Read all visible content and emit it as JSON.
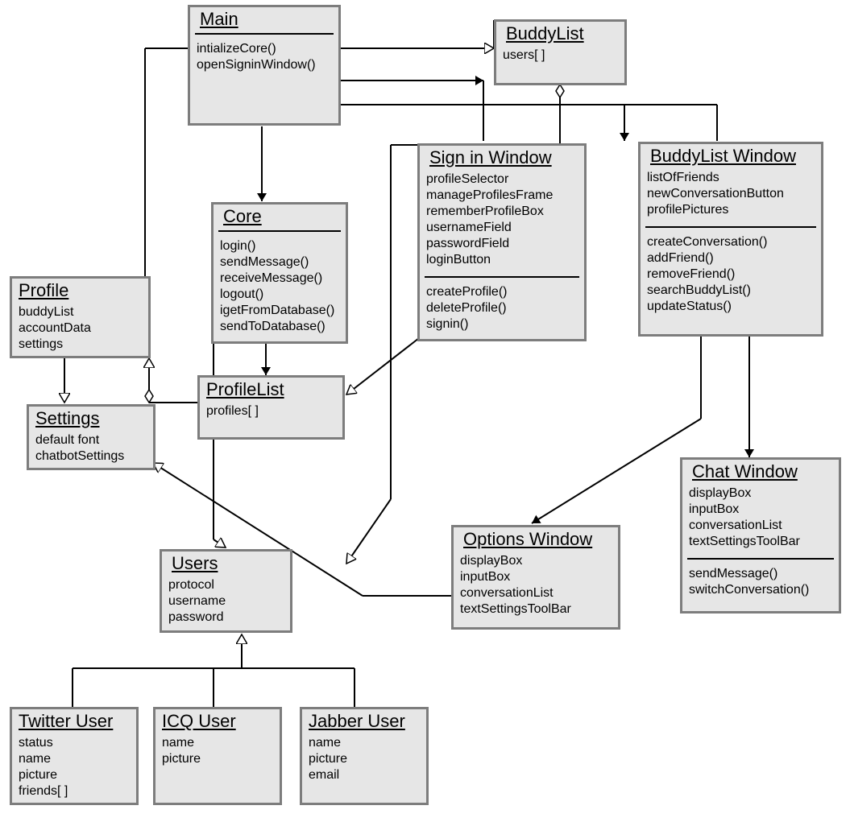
{
  "classes": {
    "main": {
      "title": "Main",
      "attrs": [],
      "ops": [
        "intializeCore()",
        "openSigninWindow()"
      ]
    },
    "buddyList": {
      "title": "BuddyList",
      "attrs": [
        "users[ ]"
      ],
      "ops": []
    },
    "core": {
      "title": "Core",
      "attrs": [],
      "ops": [
        "login()",
        "sendMessage()",
        "receiveMessage()",
        "logout()",
        "igetFromDatabase()",
        "sendToDatabase()"
      ]
    },
    "signin": {
      "title": "Sign in Window",
      "attrs": [
        "profileSelector",
        "manageProfilesFrame",
        "rememberProfileBox",
        "usernameField",
        "passwordField",
        "loginButton"
      ],
      "ops": [
        "createProfile()",
        "deleteProfile()",
        "signin()"
      ]
    },
    "buddyListWindow": {
      "title": "BuddyList Window",
      "attrs": [
        "listOfFriends",
        "newConversationButton",
        "profilePictures"
      ],
      "ops": [
        "createConversation()",
        "addFriend()",
        "removeFriend()",
        "searchBuddyList()",
        "updateStatus()"
      ]
    },
    "profile": {
      "title": "Profile",
      "attrs": [
        "buddyList",
        "accountData",
        "settings"
      ],
      "ops": []
    },
    "profileList": {
      "title": "ProfileList",
      "attrs": [
        "profiles[ ]"
      ],
      "ops": []
    },
    "settings": {
      "title": "Settings",
      "attrs": [
        "default font",
        "chatbotSettings"
      ],
      "ops": []
    },
    "users": {
      "title": "Users",
      "attrs": [
        "protocol",
        "username",
        "password"
      ],
      "ops": []
    },
    "optionsWindow": {
      "title": "Options Window",
      "attrs": [
        "displayBox",
        "inputBox",
        "conversationList",
        "textSettingsToolBar"
      ],
      "ops": []
    },
    "chatWindow": {
      "title": "Chat Window",
      "attrs": [
        "displayBox",
        "inputBox",
        "conversationList",
        "textSettingsToolBar"
      ],
      "ops": [
        "sendMessage()",
        "switchConversation()"
      ]
    },
    "twitterUser": {
      "title": "Twitter User",
      "attrs": [
        "status",
        "name",
        "picture",
        "friends[ ]"
      ],
      "ops": []
    },
    "icqUser": {
      "title": "ICQ User",
      "attrs": [
        "name",
        "picture"
      ],
      "ops": []
    },
    "jabberUser": {
      "title": "Jabber User",
      "attrs": [
        "name",
        "picture",
        "email"
      ],
      "ops": []
    }
  }
}
